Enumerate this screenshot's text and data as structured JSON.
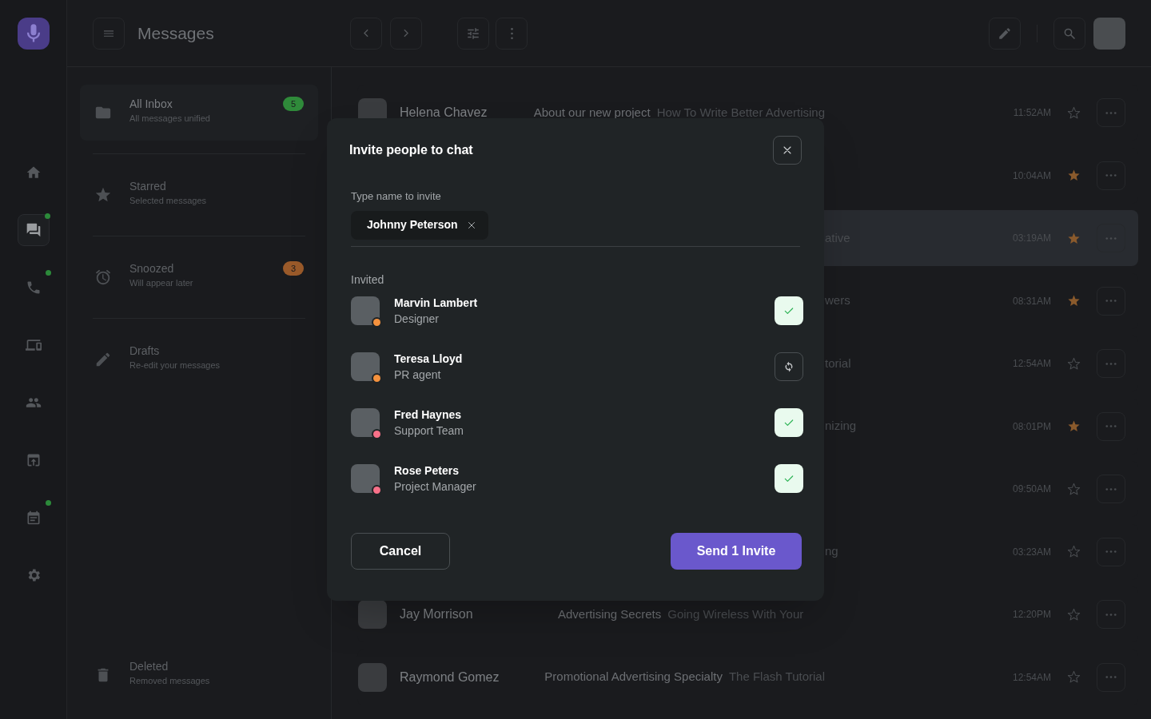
{
  "header": {
    "title": "Messages"
  },
  "rail": [
    {
      "selected": false,
      "notification": false
    },
    {
      "selected": true,
      "notification": true
    },
    {
      "selected": false,
      "notification": true
    },
    {
      "selected": false,
      "notification": false
    },
    {
      "selected": false,
      "notification": false
    },
    {
      "selected": false,
      "notification": false
    },
    {
      "selected": false,
      "notification": true
    },
    {
      "selected": false,
      "notification": false
    }
  ],
  "folders": [
    {
      "title": "All Inbox",
      "subtitle": "All messages unified",
      "badge": "5",
      "color": "#2f8a3a",
      "selected": true
    },
    {
      "title": "Starred",
      "subtitle": "Selected messages",
      "selected": false
    },
    {
      "title": "Snoozed",
      "subtitle": "Will appear later",
      "badge": "3",
      "color": "#9a5a2a",
      "selected": false
    },
    {
      "title": "Drafts",
      "subtitle": "Re-edit your messages",
      "selected": false
    },
    {
      "title": "Deleted",
      "subtitle": "Removed messages",
      "selected": false
    }
  ],
  "messages": [
    {
      "name": "Helena Chavez",
      "subject": "About our new project",
      "preview": "How To Write Better Advertising",
      "time": "11:52AM",
      "starred": false,
      "selected": false
    },
    {
      "time": "10:04AM",
      "starred": true,
      "selected": false
    },
    {
      "partial": "ative",
      "time": "03:19AM",
      "starred": true,
      "selected": true
    },
    {
      "partial": "wers",
      "time": "08:31AM",
      "starred": true,
      "selected": false
    },
    {
      "partial": "torial",
      "time": "12:54AM",
      "starred": false,
      "selected": false
    },
    {
      "partial": "nizing",
      "time": "08:01PM",
      "starred": true,
      "selected": false
    },
    {
      "time": "09:50AM",
      "starred": false,
      "selected": false
    },
    {
      "partial": "ng",
      "time": "03:23AM",
      "starred": false,
      "selected": false
    },
    {
      "name": "Jay Morrison",
      "subject": "Advertising Secrets",
      "preview": "Going Wireless With Your",
      "time": "12:20PM",
      "starred": false,
      "selected": false
    },
    {
      "name": "Raymond Gomez",
      "subject": "Promotional Advertising Specialty",
      "preview": "The Flash Tutorial",
      "time": "12:54AM",
      "starred": false,
      "selected": false
    }
  ],
  "dialog": {
    "title": "Invite people to chat",
    "field_label": "Type name to invite",
    "chips": [
      "Johnny Peterson"
    ],
    "section": "Invited",
    "members": [
      {
        "name": "Marvin Lambert",
        "role": "Designer",
        "color": "#f5923e",
        "kind": "accepted"
      },
      {
        "name": "Teresa Lloyd",
        "role": "PR agent",
        "color": "#f5923e",
        "kind": "pending"
      },
      {
        "name": "Fred Haynes",
        "role": "Support Team",
        "color": "#f87189",
        "kind": "accepted"
      },
      {
        "name": "Rose Peters",
        "role": "Project Manager",
        "color": "#f87189",
        "kind": "accepted"
      }
    ],
    "cancel": "Cancel",
    "submit": "Send 1 Invite"
  }
}
